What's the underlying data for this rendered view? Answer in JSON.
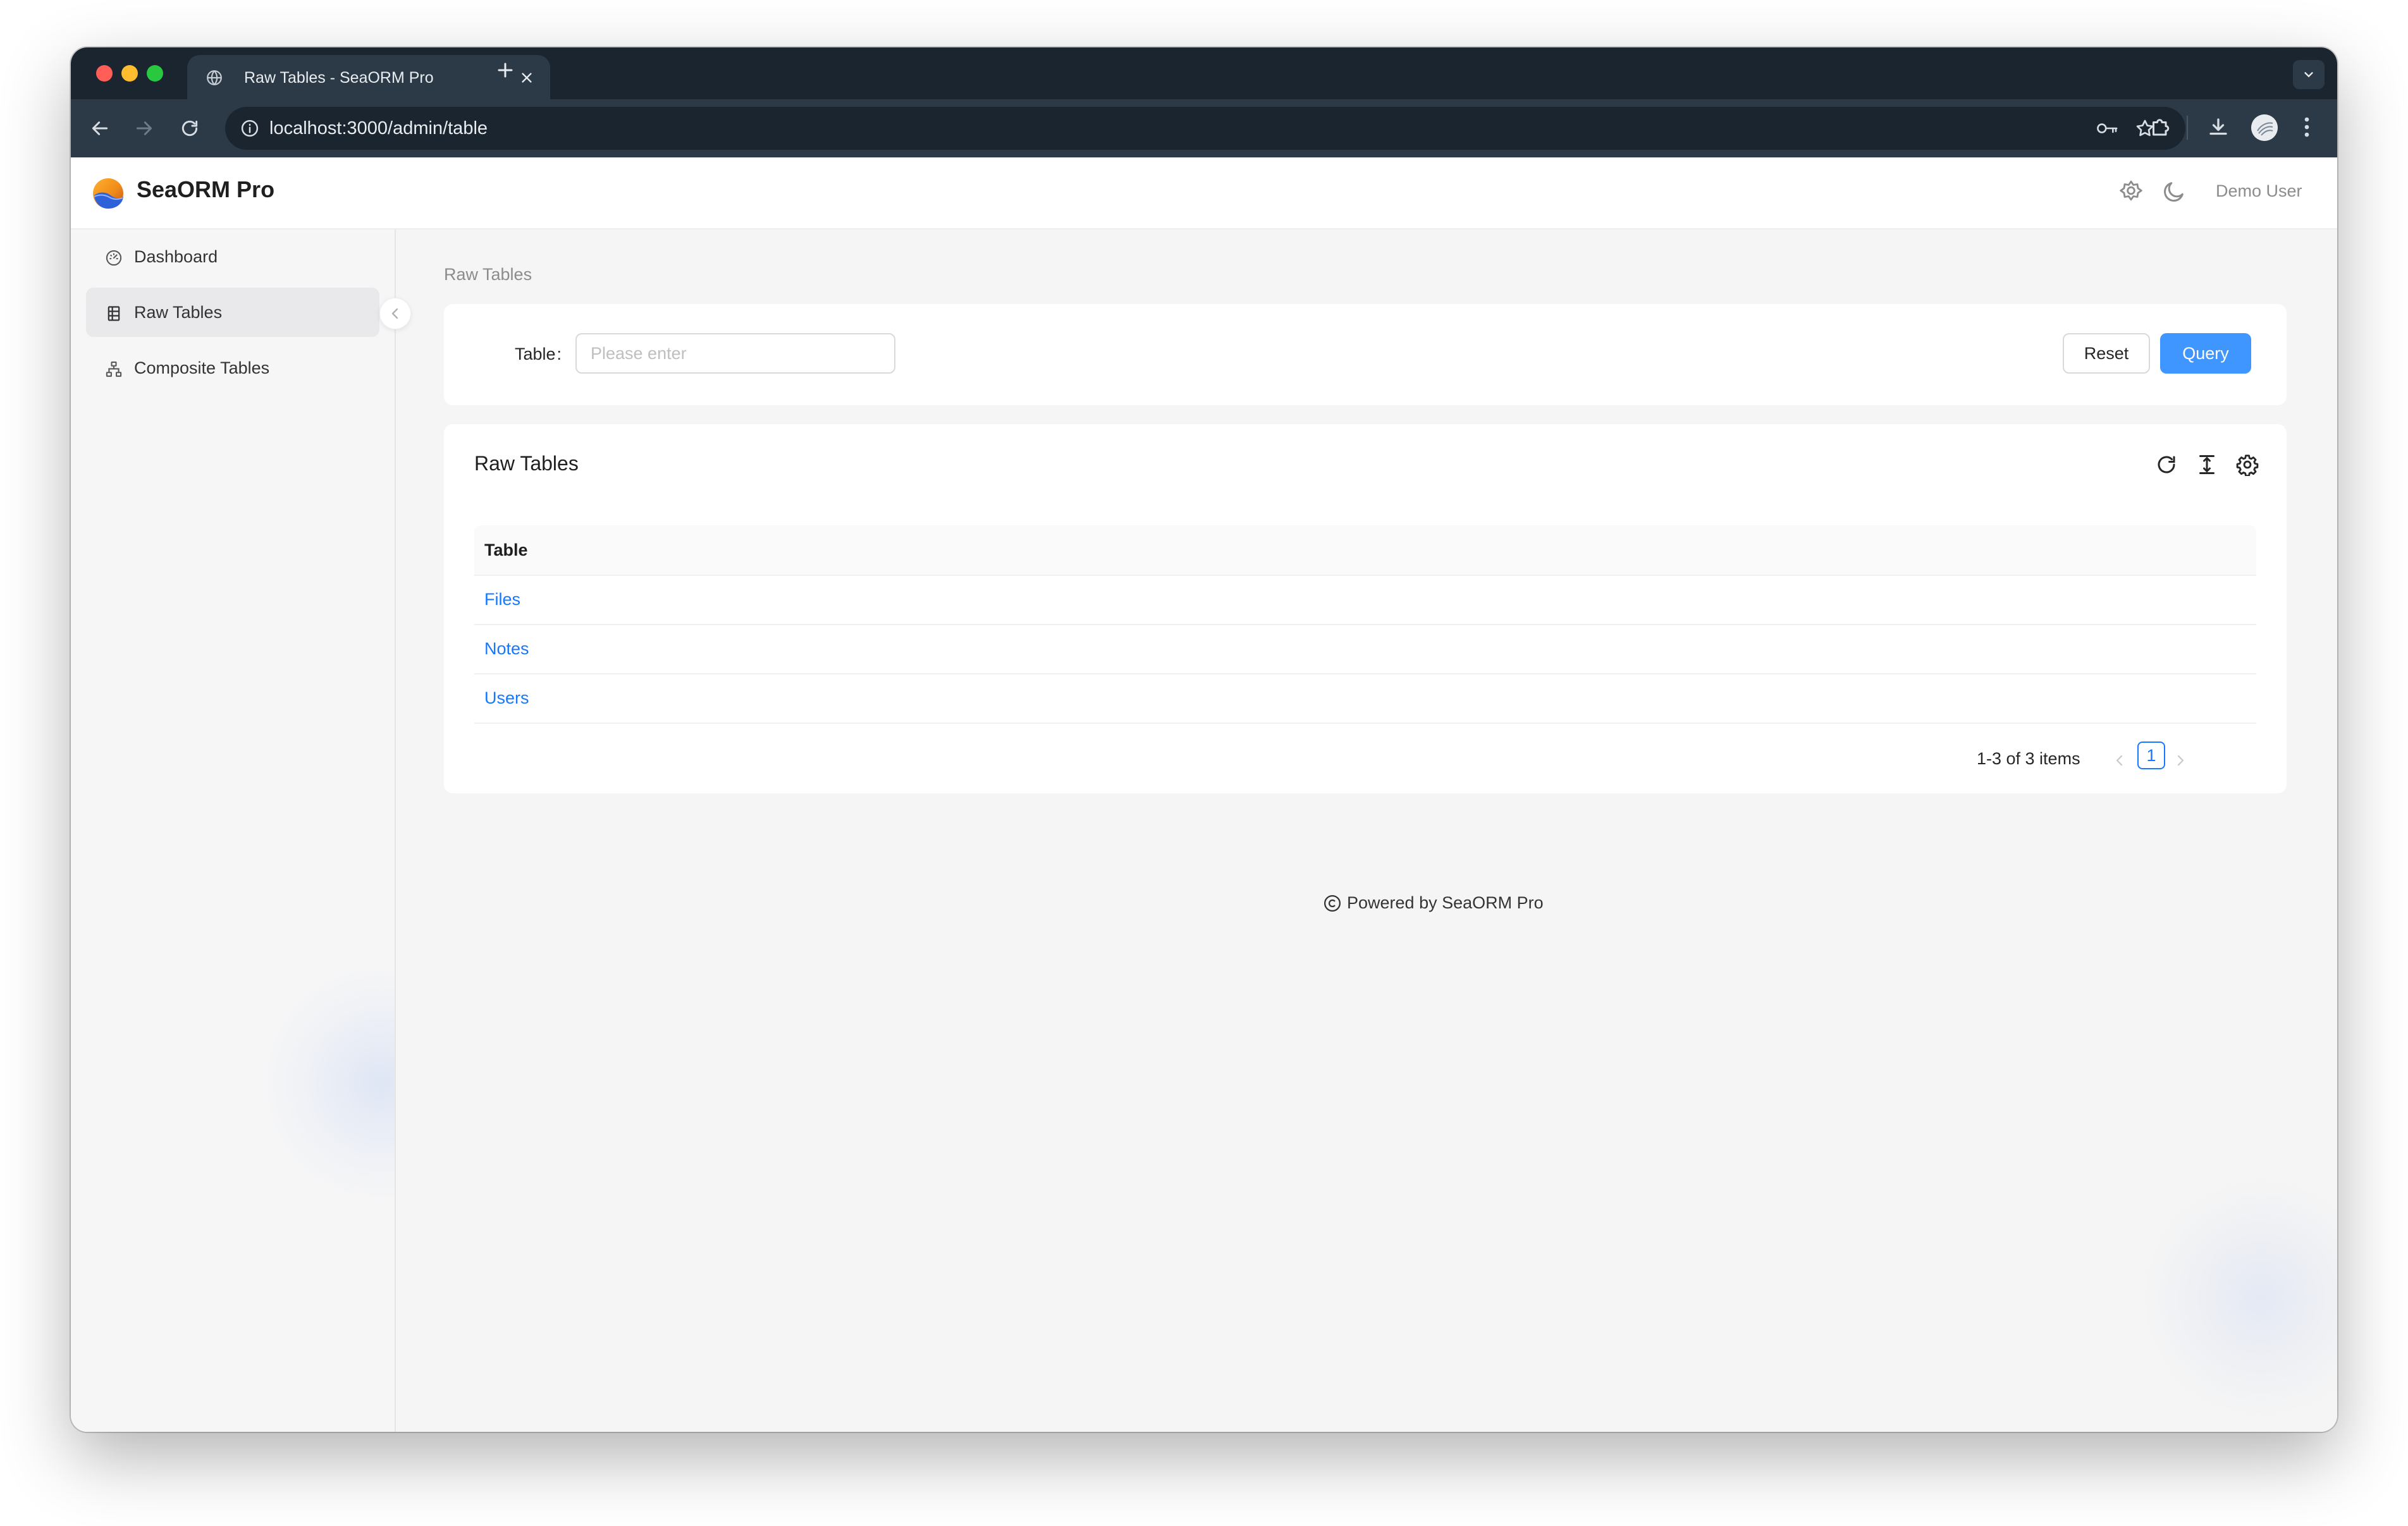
{
  "browser": {
    "tab_title": "Raw Tables - SeaORM Pro",
    "url": "localhost:3000/admin/table"
  },
  "app": {
    "title": "SeaORM Pro",
    "user_name": "Demo User"
  },
  "sidebar": {
    "items": [
      {
        "label": "Dashboard",
        "icon": "dashboard-icon",
        "active": false
      },
      {
        "label": "Raw Tables",
        "icon": "table-icon",
        "active": true
      },
      {
        "label": "Composite Tables",
        "icon": "cluster-icon",
        "active": false
      }
    ]
  },
  "breadcrumb": "Raw Tables",
  "search": {
    "label": "Table",
    "colon": ":",
    "placeholder": "Please enter",
    "reset_label": "Reset",
    "query_label": "Query"
  },
  "table": {
    "title": "Raw Tables",
    "column_header": "Table",
    "rows": [
      "Files",
      "Notes",
      "Users"
    ],
    "pagination": {
      "total_text": "1-3 of 3 items",
      "current_page": "1"
    }
  },
  "footer": {
    "text": "Powered by SeaORM Pro"
  },
  "colors": {
    "primary": "#4096ff",
    "link": "#1677ff",
    "chrome_dark": "#1b2530",
    "chrome_toolbar": "#2c3a47"
  }
}
